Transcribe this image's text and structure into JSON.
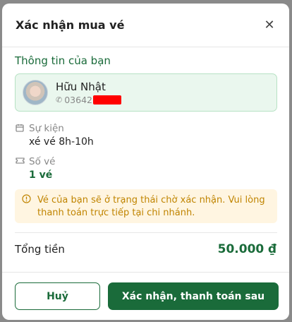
{
  "modal": {
    "title": "Xác nhận mua vé",
    "close_icon": "close-icon"
  },
  "user_section": {
    "title": "Thông tin của bạn",
    "name": "Hữu Nhật",
    "phone_visible": "03642"
  },
  "event": {
    "label": "Sự kiện",
    "value": "xé vé 8h-10h"
  },
  "tickets": {
    "label": "Số vé",
    "value": "1 vé"
  },
  "notice": {
    "text": "Vé của bạn sẽ ở trạng thái chờ xác nhận. Vui lòng thanh toán trực tiếp tại chi nhánh."
  },
  "total": {
    "label": "Tổng tiền",
    "value": "50.000 ₫"
  },
  "footer": {
    "cancel_label": "Huỷ",
    "confirm_label": "Xác nhận, thanh toán sau"
  },
  "colors": {
    "primary": "#1a6b3a",
    "card_bg": "#eaf7ee",
    "notice_bg": "#fff5e1",
    "notice_text": "#c08400",
    "redaction": "#ff0000"
  }
}
